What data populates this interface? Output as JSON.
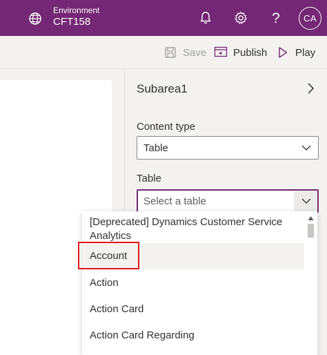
{
  "header": {
    "env_label": "Environment",
    "env_name": "CFT158",
    "icons": [
      "globe-icon",
      "bell-icon",
      "gear-icon",
      "help-icon"
    ],
    "help_glyph": "?",
    "avatar_initials": "CA",
    "brand_color": "#742774"
  },
  "commandbar": {
    "save_label": "Save",
    "publish_label": "Publish",
    "play_label": "Play"
  },
  "pane": {
    "title": "Subarea1",
    "content_type_label": "Content type",
    "content_type_value": "Table",
    "table_label": "Table",
    "table_placeholder": "Select a table"
  },
  "table_options": [
    "[Deprecated] Dynamics Customer Service Analytics",
    "Account",
    "Action",
    "Action Card",
    "Action Card Regarding"
  ],
  "highlighted_option": "Account",
  "highlight_color": "#e0191b"
}
